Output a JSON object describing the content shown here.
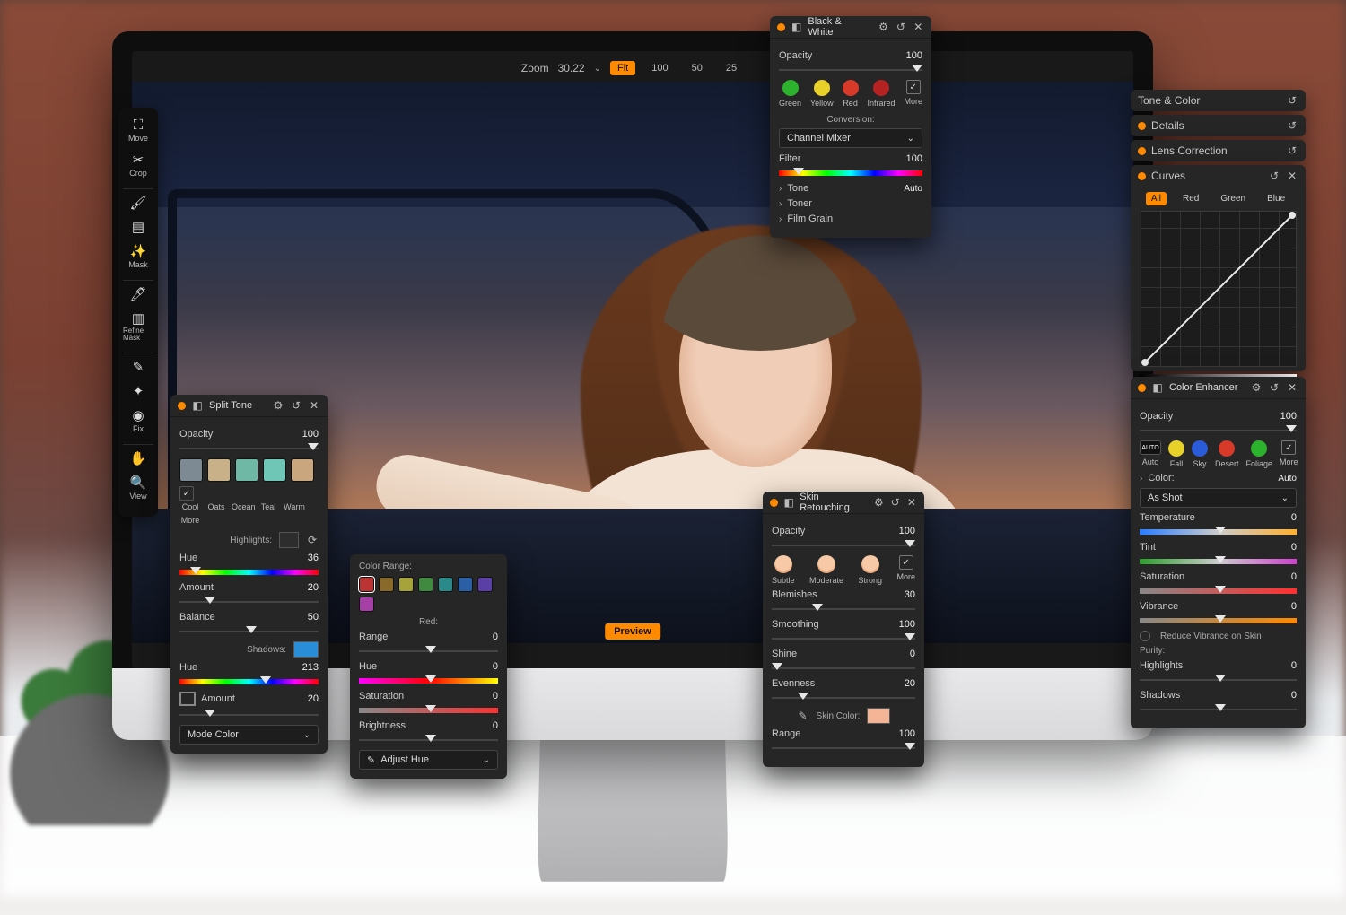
{
  "zoom": {
    "label": "Zoom",
    "value": "30.22",
    "fit": "Fit",
    "z100": "100",
    "z50": "50",
    "z25": "25"
  },
  "preview_label": "Preview",
  "toolbar": {
    "move": "Move",
    "crop": "Crop",
    "mask": "Mask",
    "refine": "Refine Mask",
    "fix": "Fix",
    "view": "View"
  },
  "split_tone": {
    "title": "Split Tone",
    "opacity_label": "Opacity",
    "opacity": "100",
    "swatches": [
      {
        "name": "Cool",
        "color": "#7d8a93"
      },
      {
        "name": "Oats",
        "color": "#c8b189"
      },
      {
        "name": "Ocean",
        "color": "#6fb8a6"
      },
      {
        "name": "Teal",
        "color": "#6fc5b6"
      },
      {
        "name": "Warm",
        "color": "#caa67e"
      }
    ],
    "more": "More",
    "highlights_label": "Highlights:",
    "hue_label": "Hue",
    "hue": "36",
    "amount_label": "Amount",
    "amount": "20",
    "balance_label": "Balance",
    "balance": "50",
    "shadows_label": "Shadows:",
    "shadow_color": "#2a8dd8",
    "shadow_hue_label": "Hue",
    "shadow_hue": "213",
    "link_amount_label": "Amount",
    "link_amount": "20",
    "mode_label": "Mode",
    "mode_value": "Color"
  },
  "color_range": {
    "heading": "Color Range:",
    "swatches": [
      "#b33",
      "#8a6a2a",
      "#a7a33b",
      "#3f8a3f",
      "#2a8a8a",
      "#2a5fa6",
      "#5a3fa6",
      "#a63fa6"
    ],
    "selected_label": "Red:",
    "range_label": "Range",
    "range": "0",
    "hue_label": "Hue",
    "hue": "0",
    "sat_label": "Saturation",
    "sat": "0",
    "bri_label": "Brightness",
    "bri": "0",
    "adjust_label": "Adjust Hue"
  },
  "bw": {
    "title": "Black & White",
    "opacity_label": "Opacity",
    "opacity": "100",
    "chips": [
      {
        "name": "Green",
        "color": "#2db22d"
      },
      {
        "name": "Yellow",
        "color": "#e8d22a"
      },
      {
        "name": "Red",
        "color": "#d83a2a"
      },
      {
        "name": "Infrared",
        "color": "#b52222"
      }
    ],
    "more": "More",
    "conversion": "Conversion:",
    "conversion_value": "Channel Mixer",
    "filter_label": "Filter",
    "filter": "100",
    "tone_label": "Tone",
    "auto": "Auto",
    "toner_label": "Toner",
    "grain_label": "Film Grain"
  },
  "right": {
    "tone_color": "Tone & Color",
    "details": "Details",
    "lens": "Lens Correction",
    "curves_title": "Curves",
    "tab_all": "All",
    "tab_red": "Red",
    "tab_green": "Green",
    "tab_blue": "Blue"
  },
  "enhancer": {
    "title": "Color Enhancer",
    "opacity_label": "Opacity",
    "opacity": "100",
    "chips": [
      {
        "name": "Auto"
      },
      {
        "name": "Fall",
        "color": "#e8d22a"
      },
      {
        "name": "Sky",
        "color": "#2a5bd8"
      },
      {
        "name": "Desert",
        "color": "#d83a2a"
      },
      {
        "name": "Foliage",
        "color": "#2db22d"
      }
    ],
    "more": "More",
    "color_label": "Color:",
    "auto": "Auto",
    "as_shot": "As Shot",
    "temp_label": "Temperature",
    "temp": "0",
    "tint_label": "Tint",
    "tint": "0",
    "sat_label": "Saturation",
    "sat": "0",
    "vib_label": "Vibrance",
    "vib": "0",
    "reduce": "Reduce Vibrance on Skin",
    "purity": "Purity:",
    "hi_label": "Highlights",
    "hi": "0",
    "sh_label": "Shadows",
    "sh": "0"
  },
  "skin": {
    "title": "Skin Retouching",
    "opacity_label": "Opacity",
    "opacity": "100",
    "presets": [
      "Subtle",
      "Moderate",
      "Strong"
    ],
    "more": "More",
    "blem_label": "Blemishes",
    "blem": "30",
    "smooth_label": "Smoothing",
    "smooth": "100",
    "shine_label": "Shine",
    "shine": "0",
    "even_label": "Evenness",
    "even": "20",
    "skin_color_label": "Skin Color:",
    "skin_color": "#f4b597",
    "range_label": "Range",
    "range": "100"
  }
}
